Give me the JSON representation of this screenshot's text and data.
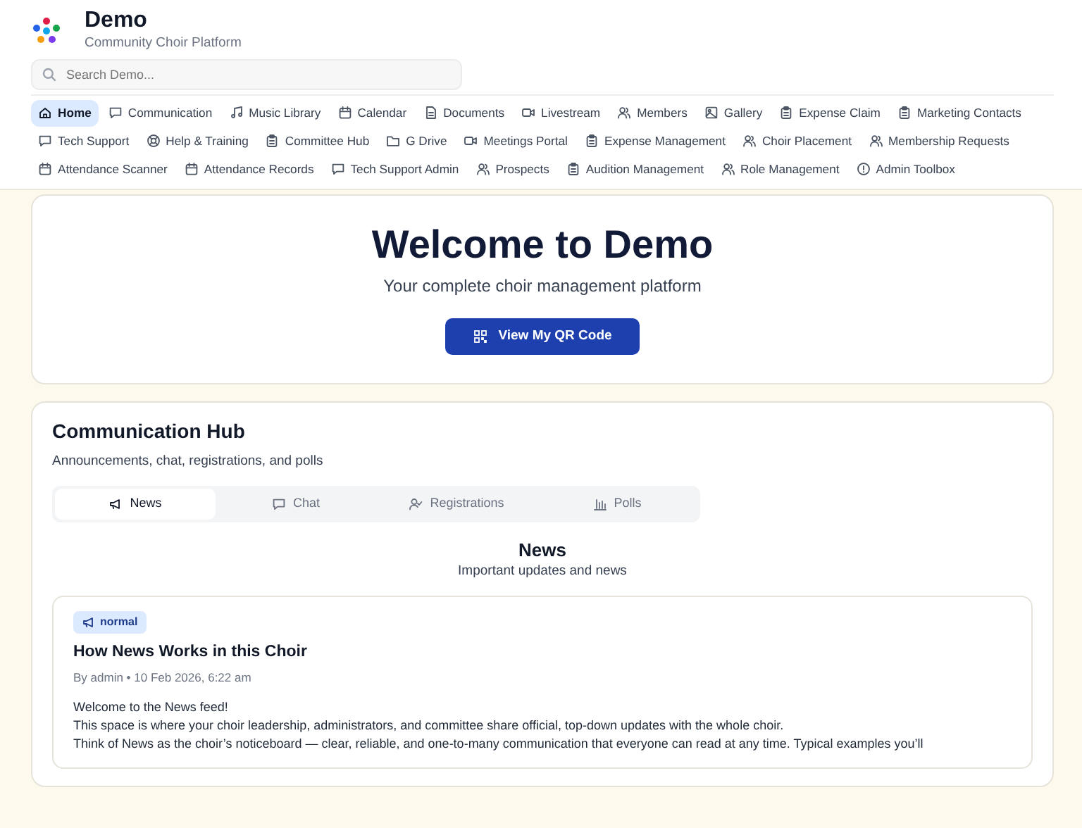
{
  "brand": {
    "title": "Demo",
    "subtitle": "Community Choir Platform"
  },
  "search": {
    "placeholder": "Search Demo..."
  },
  "nav": [
    {
      "label": "Home",
      "kind": "home",
      "selected": true
    },
    {
      "label": "Communication",
      "kind": "chat",
      "selected": false
    },
    {
      "label": "Music Library",
      "kind": "music",
      "selected": false
    },
    {
      "label": "Calendar",
      "kind": "calendar",
      "selected": false
    },
    {
      "label": "Documents",
      "kind": "document",
      "selected": false
    },
    {
      "label": "Livestream",
      "kind": "video",
      "selected": false
    },
    {
      "label": "Members",
      "kind": "users",
      "selected": false
    },
    {
      "label": "Gallery",
      "kind": "image",
      "selected": false
    },
    {
      "label": "Expense Claim",
      "kind": "clipboard",
      "selected": false
    },
    {
      "label": "Marketing Contacts",
      "kind": "clipboard",
      "selected": false
    },
    {
      "label": "Tech Support",
      "kind": "chat",
      "selected": false
    },
    {
      "label": "Help & Training",
      "kind": "help",
      "selected": false
    },
    {
      "label": "Committee Hub",
      "kind": "clipboard",
      "selected": false
    },
    {
      "label": "G Drive",
      "kind": "folder",
      "selected": false
    },
    {
      "label": "Meetings Portal",
      "kind": "video",
      "selected": false
    },
    {
      "label": "Expense Management",
      "kind": "clipboard",
      "selected": false
    },
    {
      "label": "Choir Placement",
      "kind": "users",
      "selected": false
    },
    {
      "label": "Membership Requests",
      "kind": "users",
      "selected": false
    },
    {
      "label": "Attendance Scanner",
      "kind": "calendar",
      "selected": false
    },
    {
      "label": "Attendance Records",
      "kind": "calendar",
      "selected": false
    },
    {
      "label": "Tech Support Admin",
      "kind": "chat",
      "selected": false
    },
    {
      "label": "Prospects",
      "kind": "users",
      "selected": false
    },
    {
      "label": "Audition Management",
      "kind": "clipboard",
      "selected": false
    },
    {
      "label": "Role Management",
      "kind": "users",
      "selected": false
    },
    {
      "label": "Admin Toolbox",
      "kind": "info",
      "selected": false
    }
  ],
  "hero": {
    "title": "Welcome to Demo",
    "subtitle": "Your complete choir management platform",
    "button": "View My QR Code"
  },
  "hub": {
    "title": "Communication Hub",
    "subtitle": "Announcements, chat, registrations, and polls",
    "tabs": [
      {
        "label": "News",
        "kind": "megaphone",
        "selected": true
      },
      {
        "label": "Chat",
        "kind": "chat",
        "selected": false
      },
      {
        "label": "Registrations",
        "kind": "user-check",
        "selected": false
      },
      {
        "label": "Polls",
        "kind": "bars",
        "selected": false
      }
    ],
    "section_title": "News",
    "section_subtitle": "Important updates and news",
    "post": {
      "tag": "normal",
      "title": "How News Works in this Choir",
      "meta": "By admin • 10 Feb 2026, 6:22 am",
      "lines": [
        "Welcome to the News feed!",
        "This space is where your choir leadership, administrators, and committee share official, top-down updates with the whole choir.",
        "Think of News as the choir’s noticeboard — clear, reliable, and one-to-many communication that everyone can read at any time. Typical examples you’ll"
      ]
    }
  }
}
